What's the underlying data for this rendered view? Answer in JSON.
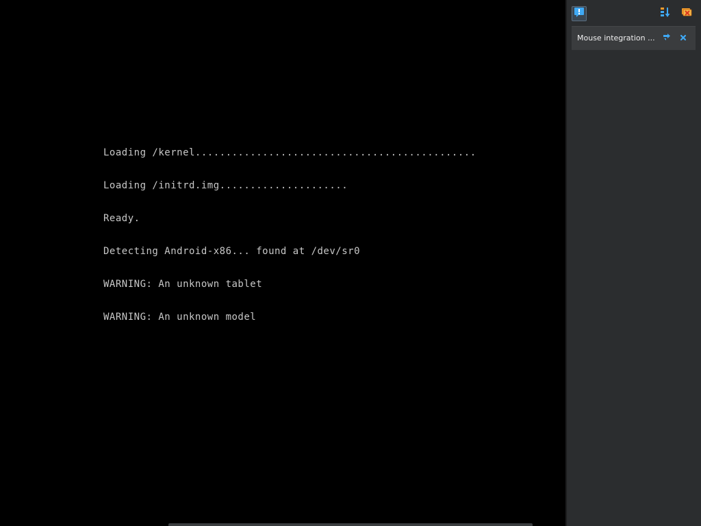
{
  "console": {
    "lines": [
      "Loading /kernel..............................................",
      "Loading /initrd.img.....................",
      "Ready.",
      "Detecting Android-x86... found at /dev/sr0",
      "WARNING: An unknown tablet",
      "WARNING: An unknown model"
    ]
  },
  "notification_panel": {
    "toolbar": {
      "notifications_icon": "notification-center-icon",
      "sort_icon": "sort-icon",
      "clear_icon": "dismiss-all-icon"
    },
    "notices": [
      {
        "text": "Mouse integration ...",
        "toggle_icon": "mouse-integration-toggle-icon",
        "close_icon": "close-icon"
      }
    ]
  },
  "colors": {
    "console_text": "#c8c8c8",
    "panel_bg": "#2b2d2f",
    "accent_blue": "#3fa9f5",
    "accent_orange": "#f39c2c"
  }
}
